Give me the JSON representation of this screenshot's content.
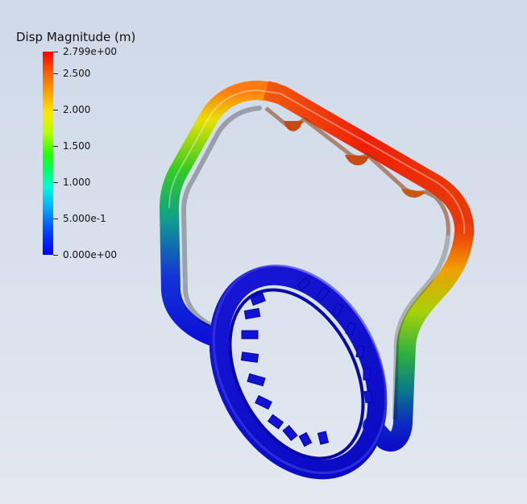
{
  "legend": {
    "title": "Disp Magnitude (m)",
    "ticks": [
      "2.799e+00",
      "2.500",
      "2.000",
      "1.500",
      "1.000",
      "5.000e-1",
      "0.000e+00"
    ]
  },
  "colors": {
    "background_top": "#cfd9e8",
    "background_bottom": "#e3e8f0",
    "colormap": [
      "#0000ff",
      "#00b4ff",
      "#00ffd0",
      "#28ff00",
      "#ffe600",
      "#ffa000",
      "#ff0000"
    ]
  }
}
